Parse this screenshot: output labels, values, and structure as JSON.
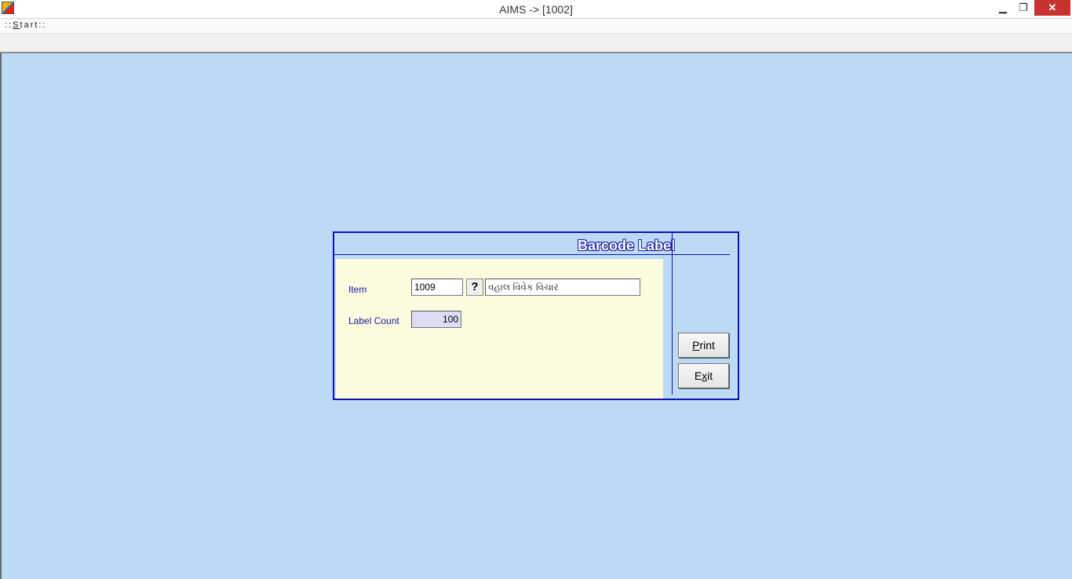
{
  "window": {
    "title": "AIMS -> [1002]",
    "min_symbol": "▁",
    "max_symbol": "❐",
    "close_symbol": "✕"
  },
  "menu": {
    "start_prefix": "::",
    "start_hotkey": "S",
    "start_rest": "tart",
    "start_suffix": "::"
  },
  "dialog": {
    "title": "Barcode Label",
    "item_label": "Item",
    "item_code": "1009",
    "lookup_symbol": "?",
    "item_name": "વહાલ વિવેક વિચાર",
    "label_count_label": "Label Count",
    "label_count_value": "100",
    "print_hotkey": "P",
    "print_rest": "rint",
    "exit_first": "E",
    "exit_hotkey": "x",
    "exit_rest": "it"
  },
  "colors": {
    "desktop": "#bcd9f5",
    "dialog_border": "#1012b0",
    "form_panel": "#fcfadf",
    "label_text": "#1a1aa0"
  }
}
